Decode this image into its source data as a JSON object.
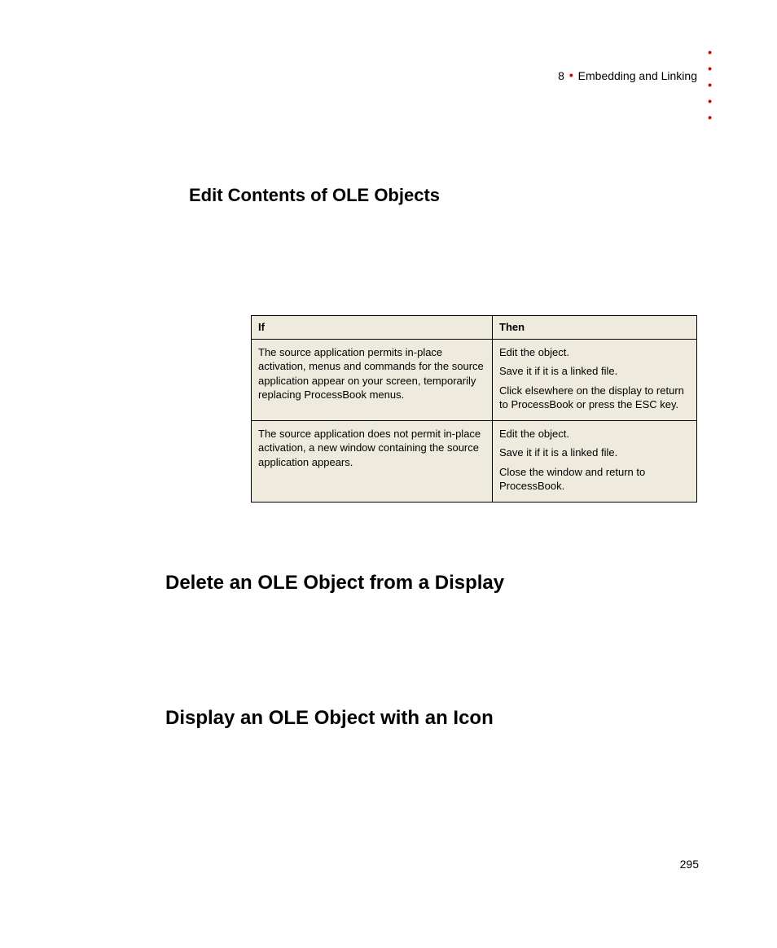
{
  "header": {
    "chapter_num": "8",
    "chapter_title": "Embedding and Linking"
  },
  "headings": {
    "edit": "Edit Contents of OLE Objects",
    "delete": "Delete an OLE Object from a Display",
    "display": "Display an OLE Object with an Icon"
  },
  "table": {
    "col_if": "If",
    "col_then": "Then",
    "rows": [
      {
        "if_text": "The source application permits in-place activation, menus and commands for the source application appear on your screen, temporarily replacing ProcessBook menus.",
        "then_lines": {
          "l1": "Edit the object.",
          "l2": "Save it if it is a linked file.",
          "l3": "Click elsewhere on the display to return to ProcessBook or press the ESC key."
        }
      },
      {
        "if_text": "The source application does not permit in-place activation, a new window containing the source application appears.",
        "then_lines": {
          "l1": "Edit the object.",
          "l2": "Save it if it is a linked file.",
          "l3": "Close the window and return to ProcessBook."
        }
      }
    ]
  },
  "page_number": "295"
}
